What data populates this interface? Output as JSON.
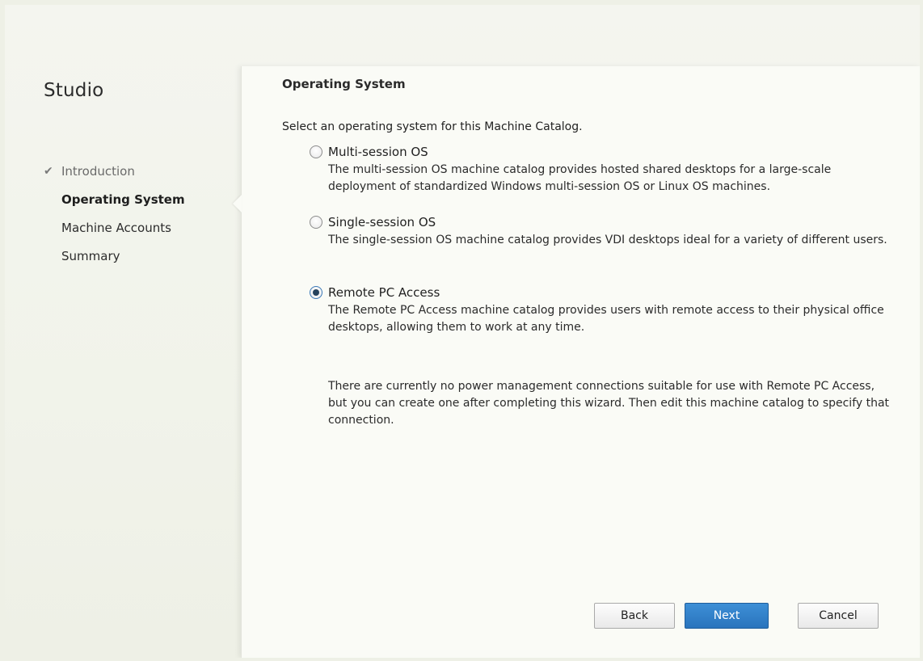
{
  "app_title": "Studio",
  "steps": [
    {
      "label": "Introduction",
      "state": "done",
      "check_icon": "✔"
    },
    {
      "label": "Operating System",
      "state": "active"
    },
    {
      "label": "Machine Accounts",
      "state": "pending"
    },
    {
      "label": "Summary",
      "state": "pending"
    }
  ],
  "page": {
    "title": "Operating System",
    "intro": "Select an operating system for this Machine Catalog.",
    "options": [
      {
        "label": "Multi-session OS",
        "description": "The multi-session OS machine catalog provides hosted shared desktops for a large-scale deployment of standardized Windows multi-session OS or Linux OS machines.",
        "selected": false
      },
      {
        "label": "Single-session OS",
        "description": "The single-session OS machine catalog provides VDI desktops ideal for a variety of different users.",
        "selected": false
      },
      {
        "label": "Remote PC Access",
        "description": "The Remote PC Access machine catalog provides users with remote access to their physical office desktops, allowing them to work at any time.",
        "selected": true
      }
    ],
    "note": "There are currently no power management connections suitable for use with Remote PC Access, but you can create one after completing this wizard. Then edit this machine catalog to specify that connection."
  },
  "buttons": {
    "back": "Back",
    "next": "Next",
    "cancel": "Cancel"
  },
  "colors": {
    "primary_button": "#2f7dc7",
    "background": "#eef0e6",
    "panel": "#fafbf6"
  }
}
